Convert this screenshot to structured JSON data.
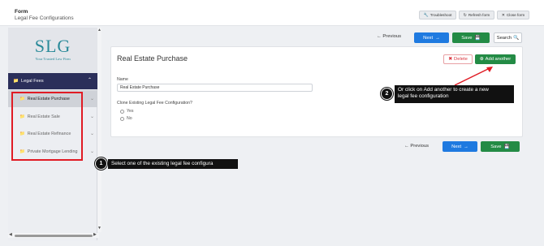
{
  "header": {
    "title": "Form",
    "subtitle": "Legal Fee Configurations",
    "buttons": {
      "troubleshoot": "Troubleshoot",
      "refresh": "Refresh form",
      "close": "Close form"
    }
  },
  "sidebar": {
    "logo": "SLG",
    "logo_tagline": "Your Trusted Law Firm",
    "section_label": "Legal Fees",
    "items": [
      {
        "label": "Real Estate Purchase"
      },
      {
        "label": "Real Estate Sale"
      },
      {
        "label": "Real Estate Refinance"
      },
      {
        "label": "Private Mortgage Lending"
      }
    ]
  },
  "nav": {
    "previous": "← Previous",
    "next": "Next",
    "save": "Save",
    "search": "Search"
  },
  "card": {
    "title": "Real Estate Purchase",
    "delete_label": "Delete",
    "add_label": "Add another",
    "name_label": "Name",
    "name_value": "Real Estate Purchase",
    "clone_label": "Clone Existing Legal Fee Configuration?",
    "options": [
      "Yes",
      "No"
    ]
  },
  "callouts": [
    {
      "number": "1",
      "text": "Select one of the existing legal fee configura"
    },
    {
      "number": "2",
      "text_line1": "Or click on Add another to create a new",
      "text_line2": "legal fee configuration"
    }
  ],
  "colors": {
    "primary": "#1f7ae0",
    "success": "#238b45",
    "danger": "#d9343d",
    "sidebar_header": "#2b2f5a",
    "logo": "#2a8a99",
    "highlight_box": "#e01b24"
  }
}
